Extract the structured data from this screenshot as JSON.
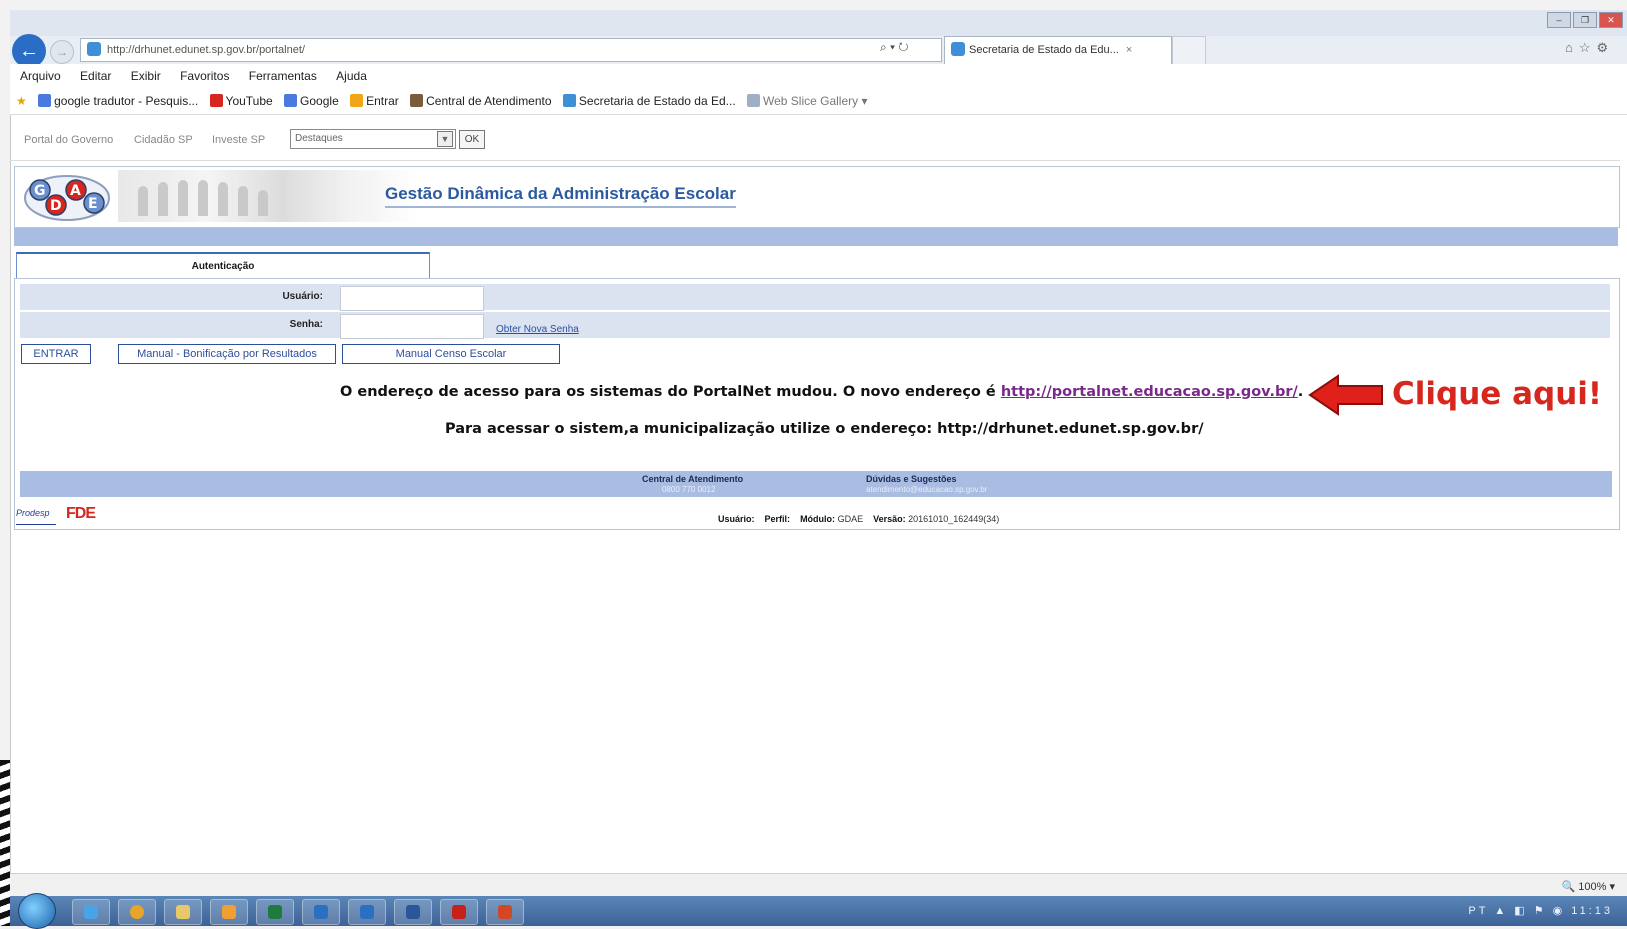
{
  "browser": {
    "url": "http://drhunet.edunet.sp.gov.br/portalnet/",
    "search_tools": "⌕ ▾ ↻",
    "tab_title": "Secretaria de Estado da Edu...",
    "tab_close": "×",
    "right_tools": "⌂☆⚙",
    "window_controls": [
      "–",
      "❐",
      "✕"
    ],
    "menu": [
      "Arquivo",
      "Editar",
      "Exibir",
      "Favoritos",
      "Ferramentas",
      "Ajuda"
    ],
    "favorites": [
      {
        "label": "google tradutor - Pesquis...",
        "icon": "google-icon",
        "color": "#4a7ae0"
      },
      {
        "label": "YouTube",
        "icon": "youtube-icon",
        "color": "#d7261e"
      },
      {
        "label": "Google",
        "icon": "google-icon",
        "color": "#4a7ae0"
      },
      {
        "label": "Entrar",
        "icon": "windows-icon",
        "color": "#f2a516"
      },
      {
        "label": "Central de Atendimento",
        "icon": "site-icon",
        "color": "#7a5b3a"
      },
      {
        "label": "Secretaria de Estado da Ed...",
        "icon": "ie-page-icon",
        "color": "#3e8fd6"
      },
      {
        "label": "Web Slice Gallery ▾",
        "icon": "ie-page-icon",
        "color": "#9fb0c4"
      }
    ],
    "zoom": "🔍 100%  ▾"
  },
  "govbar": {
    "links": [
      "Portal do Governo",
      "Cidadão SP",
      "Investe SP"
    ],
    "select_value": "Destaques",
    "ok_label": "OK"
  },
  "header": {
    "logo_text": "GDAE",
    "title": "Gestão Dinâmica da Administração Escolar"
  },
  "auth": {
    "tab_label": "Autenticação",
    "user_label": "Usuário:",
    "user_value": "",
    "pass_label": "Senha:",
    "pass_value": "",
    "new_password_link": "Obter Nova Senha",
    "enter_button": "ENTRAR",
    "manual_bonus_button": "Manual - Bonificação por Resultados",
    "manual_census_button": "Manual Censo Escolar"
  },
  "notices": {
    "line1_prefix": "O endereço de acesso para os sistemas do PortalNet mudou. O novo endereço é ",
    "line1_link": "http://portalnet.educacao.sp.gov.br/",
    "line1_suffix": ".",
    "line2": "Para acessar o sistem,a municipalização utilize o endereço: http://drhunet.edunet.sp.gov.br/"
  },
  "callout": {
    "text": "Clique aqui!",
    "color": "#d7261e"
  },
  "footer": {
    "support_title": "Central de Atendimento",
    "support_phone": "0800 770 0012",
    "suggest_title": "Dúvidas e Sugestões",
    "suggest_email": "atendimento@educacao.sp.gov.br",
    "prodesp_logo": "Prodesp",
    "fde_logo": "FDE",
    "user_label": "Usuário:",
    "profile_label": "Perfil:",
    "module_label": "Módulo:",
    "module_value": "GDAE",
    "version_label": "Versão:",
    "version_value": "20161010_162449(34)"
  },
  "taskbar": {
    "tray": "PT  ▲  ◧  ⚑  ◉     11:13"
  }
}
